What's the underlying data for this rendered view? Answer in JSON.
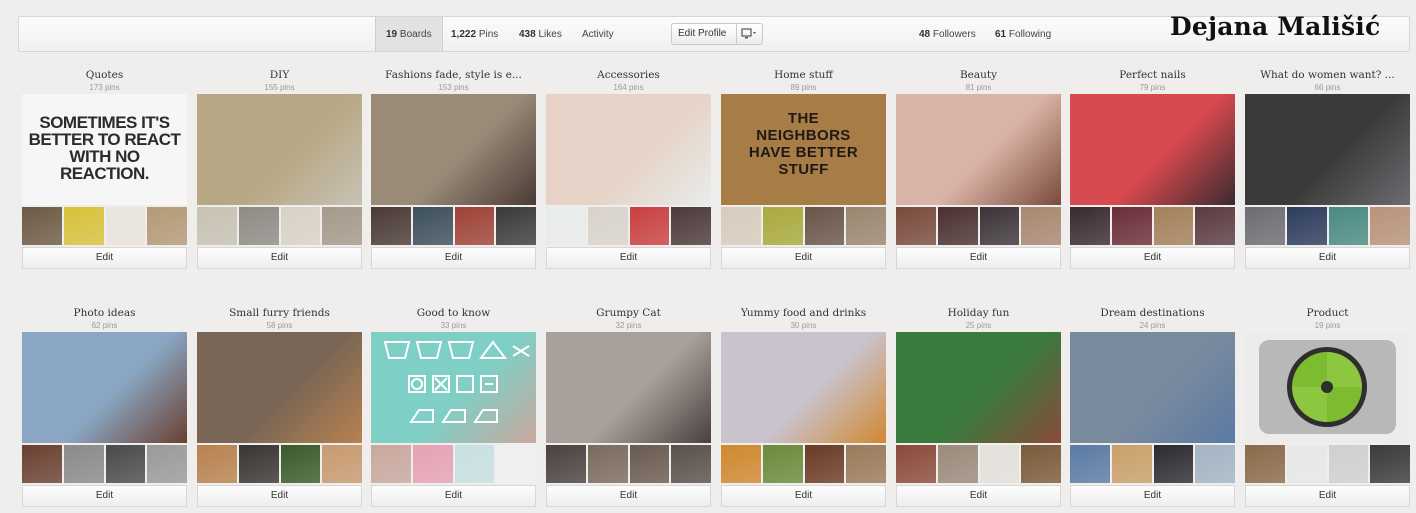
{
  "header": {
    "tabs": [
      {
        "count": "19",
        "label": "Boards"
      },
      {
        "count": "1,222",
        "label": "Pins"
      },
      {
        "count": "438",
        "label": "Likes"
      },
      {
        "count": "",
        "label": "Activity"
      }
    ],
    "edit_profile_label": "Edit Profile",
    "followers": {
      "count": "48",
      "label": "Followers"
    },
    "following": {
      "count": "61",
      "label": "Following"
    },
    "username": "Dejana Mališić"
  },
  "edit_label": "Edit",
  "boards": [
    {
      "name": "Quotes",
      "pins": "173 pins",
      "cover_text": [
        "SOMETIMES IT'S",
        "BETTER TO REACT",
        "WITH NO",
        "REACTION."
      ],
      "colors": [
        "#f6f6f6",
        "#6d5a44",
        "#d8c23a",
        "#e9e4dc",
        "#b49a76"
      ]
    },
    {
      "name": "DIY",
      "pins": "155 pins",
      "colors": [
        "#b7a784",
        "#c8c2b4",
        "#8f8c86",
        "#d9d2c8",
        "#a59a8a"
      ]
    },
    {
      "name": "Fashions fade, style is e...",
      "pins": "153 pins",
      "colors": [
        "#9a8a78",
        "#4a3a35",
        "#3c4f5c",
        "#9e4236",
        "#3a3a3a"
      ]
    },
    {
      "name": "Accessories",
      "pins": "164 pins",
      "colors": [
        "#e6d2c6",
        "#e8ecea",
        "#d9d3cc",
        "#c9403f",
        "#4c3a3a"
      ]
    },
    {
      "name": "Home stuff",
      "pins": "89 pins",
      "cover_text": [
        "THE",
        "NEIGHBORS",
        "HAVE BETTER",
        "STUFF"
      ],
      "colors": [
        "#a87c47",
        "#d7cdbd",
        "#a9aa3c",
        "#6a5548",
        "#9a8670"
      ]
    },
    {
      "name": "Beauty",
      "pins": "81 pins",
      "colors": [
        "#d9b3a5",
        "#7a4a3c",
        "#4a3030",
        "#3c3438",
        "#a98770"
      ]
    },
    {
      "name": "Perfect nails",
      "pins": "79 pins",
      "colors": [
        "#d94a4e",
        "#3a2a30",
        "#6a2d3a",
        "#a4805a",
        "#5a3a40"
      ]
    },
    {
      "name": "What do women want? ...",
      "pins": "66 pins",
      "colors": [
        "#3c3a38",
        "#6c6c72",
        "#2c3c5c",
        "#4a8a84",
        "#b8937a"
      ]
    },
    {
      "name": "Photo ideas",
      "pins": "62 pins",
      "colors": [
        "#8aa6c4",
        "#6a4030",
        "#8a8a8a",
        "#4a4a4a",
        "#9a9a9a"
      ]
    },
    {
      "name": "Small furry friends",
      "pins": "58 pins",
      "colors": [
        "#7a6656",
        "#b8824e",
        "#3a3430",
        "#3a5a2a",
        "#c89a70"
      ]
    },
    {
      "name": "Good to know",
      "pins": "33 pins",
      "colors": [
        "#7ecfc6",
        "#c9a89e",
        "#e6a2b4",
        "#c8e0e2",
        "#f0efef"
      ]
    },
    {
      "name": "Grumpy Cat",
      "pins": "32 pins",
      "colors": [
        "#a8a09a",
        "#4a4040",
        "#7a6a5e",
        "#6a5a50",
        "#5a504a"
      ]
    },
    {
      "name": "Yummy food and drinks",
      "pins": "30 pins",
      "colors": [
        "#c9c3ce",
        "#d0882e",
        "#6a8a3a",
        "#6a3a24",
        "#9a7a5a"
      ]
    },
    {
      "name": "Holiday fun",
      "pins": "25 pins",
      "colors": [
        "#3a7a3c",
        "#8a4a3a",
        "#9a8a7a",
        "#e4e0dc",
        "#7a5a3a"
      ]
    },
    {
      "name": "Dream destinations",
      "pins": "24 pins",
      "colors": [
        "#7a8a9e",
        "#5a7aa4",
        "#caa06a",
        "#2c2a30",
        "#a4b4c4"
      ]
    },
    {
      "name": "Product",
      "pins": "19 pins",
      "colors": [
        "#e8e8e8",
        "#8a6a4a",
        "#e8e8e8",
        "#d0d0d0",
        "#3a3a3a"
      ]
    }
  ]
}
